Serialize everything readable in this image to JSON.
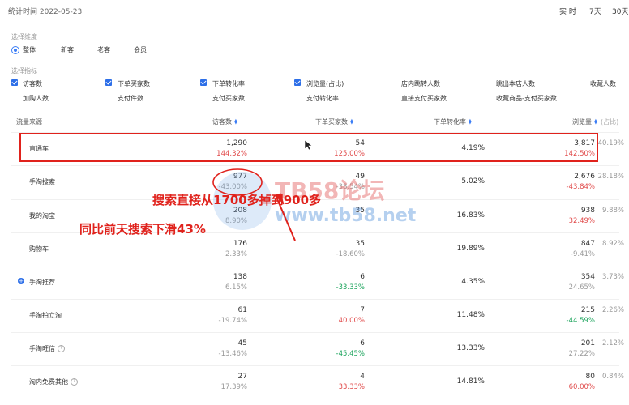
{
  "header": {
    "stat_time": "统计时间 2022-05-23",
    "range_options": [
      "实 时",
      "7天",
      "30天"
    ]
  },
  "dimension": {
    "label": "选择维度",
    "options": [
      "整体",
      "新客",
      "老客",
      "会员"
    ],
    "selected": "整体"
  },
  "metrics": {
    "label": "选择指标",
    "row1": [
      {
        "label": "访客数",
        "checked": true
      },
      {
        "label": "下单买家数",
        "checked": true
      },
      {
        "label": "下单转化率",
        "checked": true
      },
      {
        "label": "浏览量(占比)",
        "checked": true
      },
      {
        "label": "店内跳转人数",
        "checked": false
      },
      {
        "label": "跳出本店人数",
        "checked": false
      },
      {
        "label": "收藏人数",
        "checked": false
      }
    ],
    "row2": [
      "加购人数",
      "支付件数",
      "支付买家数",
      "支付转化率",
      "直接支付买家数",
      "收藏商品-支付买家数"
    ]
  },
  "table": {
    "columns": [
      "流量来源",
      "访客数",
      "下单买家数",
      "下单转化率",
      "浏览量",
      "(占比)"
    ],
    "rows": [
      {
        "name": "直通车",
        "visitors": "1,290",
        "visitors_chg": "144.32%",
        "visitors_color": "red",
        "buyers": "54",
        "buyers_chg": "125.00%",
        "buyers_color": "red",
        "conv": "4.19%",
        "pv": "3,817",
        "pv_chg": "142.50%",
        "pv_color": "red",
        "share": "40.19%"
      },
      {
        "name": "手淘搜索",
        "visitors": "977",
        "visitors_chg": "-43.00%",
        "visitors_color": "gray",
        "buyers": "49",
        "buyers_chg": "-38.54%",
        "buyers_color": "gray",
        "conv": "5.02%",
        "pv": "2,676",
        "pv_chg": "-43.84%",
        "pv_color": "red",
        "share": "28.18%"
      },
      {
        "name": "我的淘宝",
        "visitors": "208",
        "visitors_chg": "8.90%",
        "visitors_color": "gray",
        "buyers": "35",
        "buyers_chg": "",
        "buyers_color": "gray",
        "conv": "16.83%",
        "pv": "938",
        "pv_chg": "32.49%",
        "pv_color": "red",
        "share": "9.88%"
      },
      {
        "name": "购物车",
        "visitors": "176",
        "visitors_chg": "2.33%",
        "visitors_color": "gray",
        "buyers": "35",
        "buyers_chg": "-18.60%",
        "buyers_color": "gray",
        "conv": "19.89%",
        "pv": "847",
        "pv_chg": "-9.41%",
        "pv_color": "gray",
        "share": "8.92%"
      },
      {
        "name": "手淘推荐",
        "visitors": "138",
        "visitors_chg": "6.15%",
        "visitors_color": "gray",
        "buyers": "6",
        "buyers_chg": "-33.33%",
        "buyers_color": "green",
        "conv": "4.35%",
        "pv": "354",
        "pv_chg": "24.65%",
        "pv_color": "gray",
        "share": "3.73%"
      },
      {
        "name": "手淘拍立淘",
        "visitors": "61",
        "visitors_chg": "-19.74%",
        "visitors_color": "gray",
        "buyers": "7",
        "buyers_chg": "40.00%",
        "buyers_color": "red",
        "conv": "11.48%",
        "pv": "215",
        "pv_chg": "-44.59%",
        "pv_color": "green",
        "share": "2.26%"
      },
      {
        "name": "手淘旺信",
        "visitors": "45",
        "visitors_chg": "-13.46%",
        "visitors_color": "gray",
        "buyers": "6",
        "buyers_chg": "-45.45%",
        "buyers_color": "green",
        "conv": "13.33%",
        "pv": "201",
        "pv_chg": "27.22%",
        "pv_color": "gray",
        "share": "2.12%"
      },
      {
        "name": "淘内免费其他",
        "visitors": "27",
        "visitors_chg": "17.39%",
        "visitors_color": "gray",
        "buyers": "4",
        "buyers_chg": "33.33%",
        "buyers_color": "red",
        "conv": "14.81%",
        "pv": "80",
        "pv_chg": "60.00%",
        "pv_color": "red",
        "share": "0.84%"
      }
    ]
  },
  "annotations": {
    "line1": "搜索直接从1700多掉到900多",
    "line2": "同比前天搜索下滑43%"
  },
  "watermark": {
    "text1": "TB58论坛",
    "text2": "www.tb58.net"
  },
  "colors": {
    "accent": "#2d6fe8",
    "highlight_box": "#e0221c",
    "negative": "#e04848",
    "positive": "#1aa35b"
  }
}
